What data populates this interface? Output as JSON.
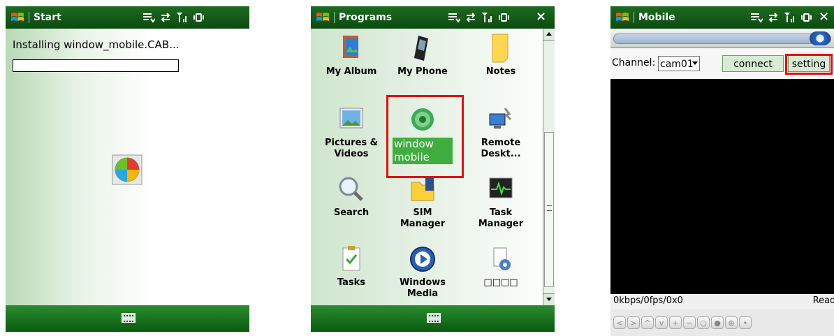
{
  "screens": {
    "install": {
      "title": "Start",
      "message": "Installing  window_mobile.CAB...",
      "progress_fraction": 0.0
    },
    "programs": {
      "title": "Programs",
      "items": [
        {
          "label": "My Album",
          "icon": "album-icon"
        },
        {
          "label": "My Phone",
          "icon": "phone-icon"
        },
        {
          "label": "Notes",
          "icon": "notes-icon"
        },
        {
          "label": "Pictures &",
          "label2": "Videos",
          "icon": "pictures-icon"
        },
        {
          "label": "window",
          "label2": "mobile",
          "icon": "window-mobile-icon",
          "selected": true
        },
        {
          "label": "Remote",
          "label2": "Deskt...",
          "icon": "remote-desktop-icon"
        },
        {
          "label": "Search",
          "icon": "search-icon"
        },
        {
          "label": "SIM",
          "label2": "Manager",
          "icon": "sim-manager-icon"
        },
        {
          "label": "Task",
          "label2": "Manager",
          "icon": "task-manager-icon"
        },
        {
          "label": "Tasks",
          "icon": "tasks-icon"
        },
        {
          "label": "Windows",
          "label2": "Media",
          "icon": "windows-media-icon"
        },
        {
          "label": "□□□□",
          "icon": "unknown-app-icon"
        }
      ]
    },
    "mobile": {
      "title": "Mobile",
      "channel_label": "Channel:",
      "channel_value": "cam01",
      "connect_label": "connect",
      "setting_label": "setting",
      "stats": "0kbps/0fps/0x0",
      "status": "Ready",
      "nav_buttons": [
        "<",
        ">",
        "^",
        "v",
        "+",
        "−",
        "○",
        "●",
        "⊕",
        "•"
      ]
    }
  },
  "colors": {
    "titlebar": "#0b4a10",
    "highlight": "#e01010",
    "selection": "#3fae3f"
  }
}
